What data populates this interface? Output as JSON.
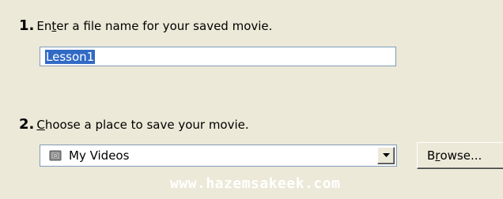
{
  "step1": {
    "number": "1.",
    "label_pre": "En",
    "label_mnemonic": "t",
    "label_post": "er a file name for your saved movie.",
    "filename_value": "Lesson1"
  },
  "step2": {
    "number": "2.",
    "label_mnemonic": "C",
    "label_post": "hoose a place to save your movie.",
    "folder_selected": "My Videos",
    "folder_icon": "video-folder-icon",
    "browse_pre": "B",
    "browse_mnemonic": "r",
    "browse_post": "owse..."
  },
  "watermark": "www.hazemsakeek.com",
  "colors": {
    "background": "#ece9d8",
    "selection": "#316ac5",
    "input_border": "#7f9db9"
  }
}
